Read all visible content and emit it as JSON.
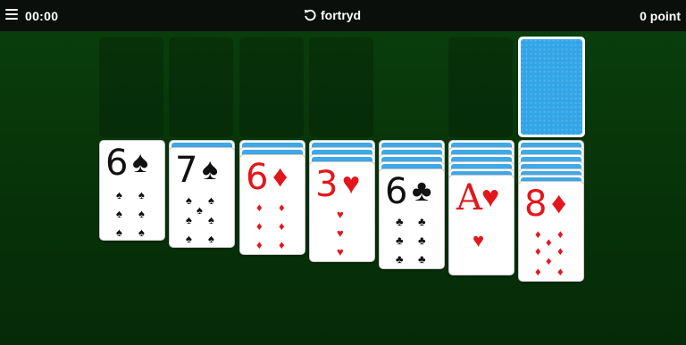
{
  "header": {
    "timer": "00:00",
    "undo_label": "fortryd",
    "score": "0 point"
  },
  "colors": {
    "felt": "#0a3f0d",
    "topbar": "#0b0f0b",
    "card_back": "#32a5e6",
    "red_suit": "#e3171b"
  },
  "foundations": [
    {
      "card": null
    },
    {
      "card": null
    },
    {
      "card": null
    },
    {
      "card": null
    }
  ],
  "waste": {
    "card": null
  },
  "stock": {
    "face_down": true
  },
  "tableau": [
    {
      "hidden": 0,
      "top": {
        "rank": "6",
        "suit": "♠",
        "color": "black"
      }
    },
    {
      "hidden": 1,
      "top": {
        "rank": "7",
        "suit": "♠",
        "color": "black"
      }
    },
    {
      "hidden": 2,
      "top": {
        "rank": "6",
        "suit": "♦",
        "color": "red"
      }
    },
    {
      "hidden": 3,
      "top": {
        "rank": "3",
        "suit": "♥",
        "color": "red"
      }
    },
    {
      "hidden": 4,
      "top": {
        "rank": "6",
        "suit": "♣",
        "color": "black"
      }
    },
    {
      "hidden": 5,
      "top": {
        "rank": "A",
        "suit": "♥",
        "color": "red"
      }
    },
    {
      "hidden": 6,
      "top": {
        "rank": "8",
        "suit": "♦",
        "color": "red"
      }
    }
  ]
}
